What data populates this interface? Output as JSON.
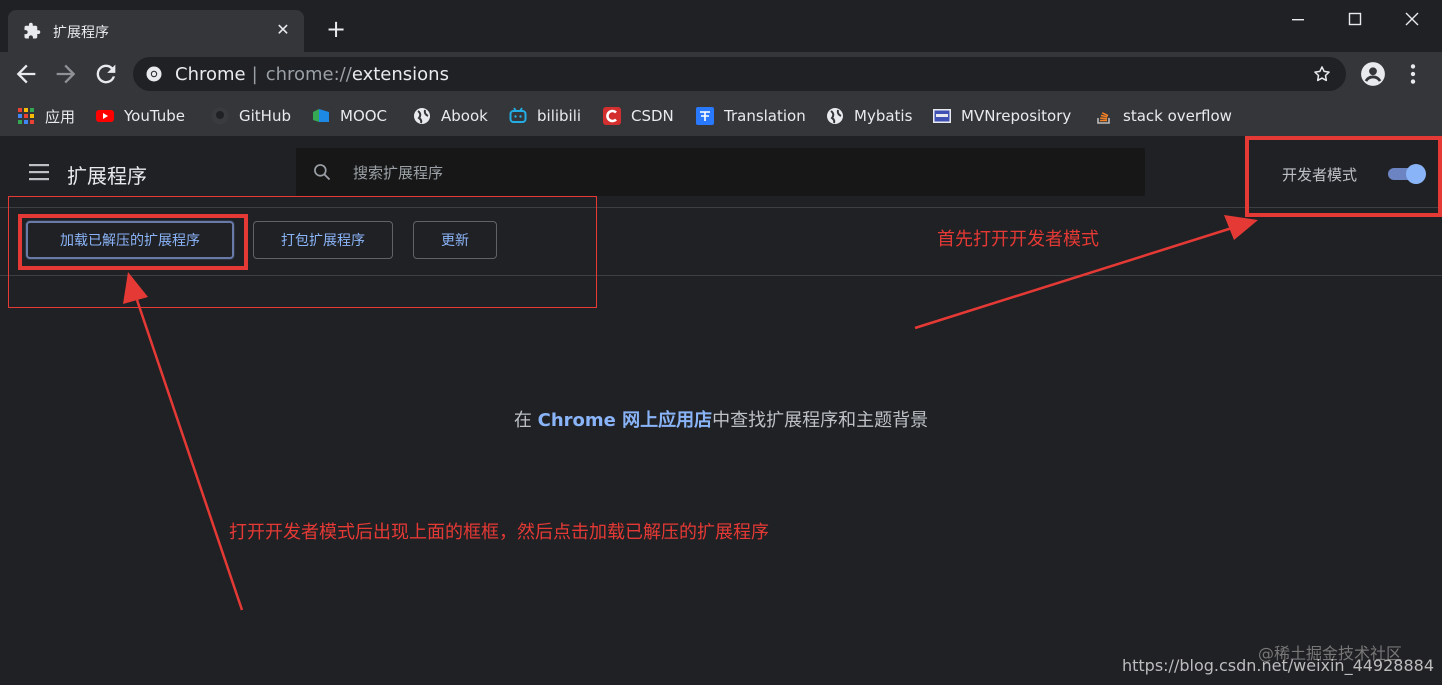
{
  "tab": {
    "title": "扩展程序",
    "close_label": "✕",
    "new_tab_label": "+"
  },
  "window": {
    "minimize": "—",
    "maximize": "☐",
    "close": "✕"
  },
  "omnibox": {
    "site_name": "Chrome",
    "separator": "|",
    "scheme": "chrome://",
    "host": "extensions"
  },
  "bookmarks": [
    {
      "label": "应用",
      "icon": "apps-grid-icon"
    },
    {
      "label": "YouTube",
      "icon": "youtube-icon"
    },
    {
      "label": "GitHub",
      "icon": "github-icon"
    },
    {
      "label": "MOOC",
      "icon": "mooc-icon"
    },
    {
      "label": "Abook",
      "icon": "globe-icon"
    },
    {
      "label": "bilibili",
      "icon": "bilibili-icon"
    },
    {
      "label": "CSDN",
      "icon": "csdn-icon"
    },
    {
      "label": "Translation",
      "icon": "translate-icon"
    },
    {
      "label": "Mybatis",
      "icon": "globe-icon"
    },
    {
      "label": "MVNrepository",
      "icon": "mvn-icon"
    },
    {
      "label": "stack overflow",
      "icon": "stackoverflow-icon"
    }
  ],
  "page": {
    "title": "扩展程序",
    "search_placeholder": "搜索扩展程序",
    "developer_mode_label": "开发者模式",
    "developer_mode_on": true,
    "buttons": {
      "load_unpacked": "加载已解压的扩展程序",
      "pack": "打包扩展程序",
      "update": "更新"
    },
    "store_prefix": "在 ",
    "store_link": "Chrome 网上应用店",
    "store_suffix": "中查找扩展程序和主题背景"
  },
  "annotations": {
    "first_step": "首先打开开发者模式",
    "second_step": "打开开发者模式后出现上面的框框，然后点击加载已解压的扩展程序",
    "color": "#e53935"
  },
  "watermark": {
    "line1": "@稀土掘金技术社区",
    "line2": "https://blog.csdn.net/weixin_44928884"
  },
  "colors": {
    "accent": "#8ab4f8",
    "background": "#202124",
    "toolbar": "#35363a"
  }
}
